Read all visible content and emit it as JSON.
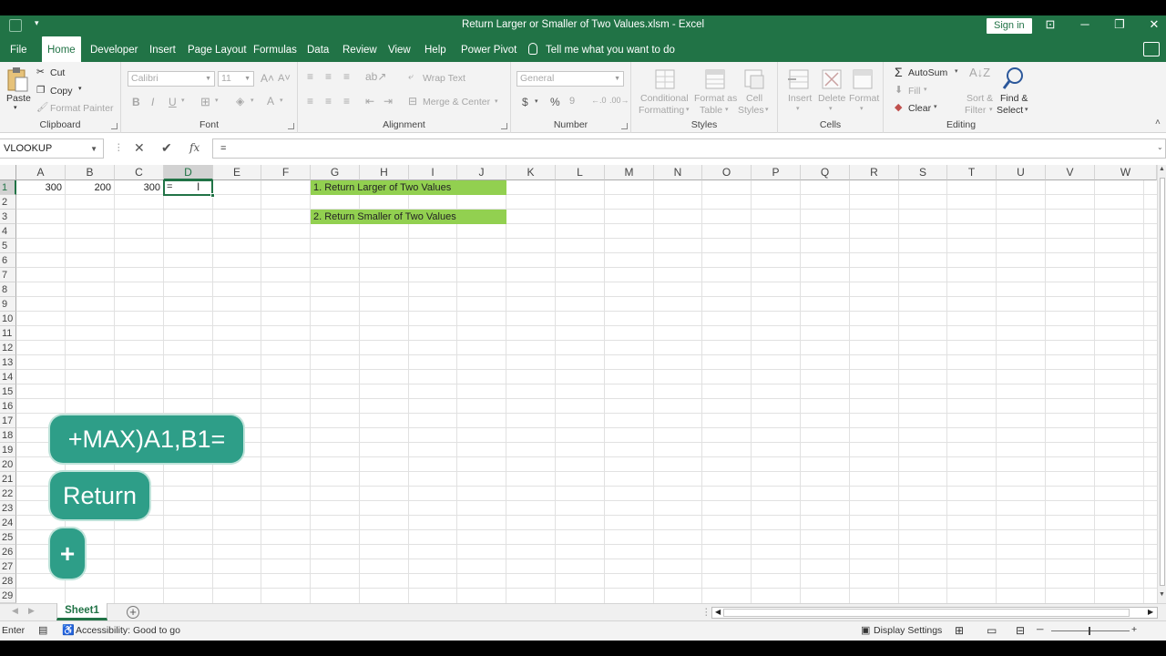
{
  "window": {
    "title": "Return Larger or Smaller of Two Values.xlsm  -  Excel",
    "sign_in": "Sign in"
  },
  "ribbon_tabs": [
    "File",
    "Home",
    "Developer",
    "Insert",
    "Page Layout",
    "Formulas",
    "Data",
    "Review",
    "View",
    "Help",
    "Power Pivot"
  ],
  "tell_me": "Tell me what you want to do",
  "clipboard": {
    "paste": "Paste",
    "cut": "Cut",
    "copy": "Copy",
    "format_painter": "Format Painter",
    "label": "Clipboard"
  },
  "font": {
    "name": "Calibri",
    "size": "11",
    "bold": "B",
    "italic": "I",
    "underline": "U",
    "label": "Font"
  },
  "alignment": {
    "wrap_text": "Wrap Text",
    "merge_center": "Merge & Center",
    "label": "Alignment"
  },
  "number": {
    "format": "General",
    "currency": "$",
    "percent": "%",
    "label": "Number"
  },
  "styles": {
    "conditional_1": "Conditional",
    "conditional_2": "Formatting",
    "format_as_1": "Format as",
    "format_as_2": "Table",
    "cell_styles_1": "Cell",
    "cell_styles_2": "Styles",
    "label": "Styles"
  },
  "cells": {
    "insert": "Insert",
    "delete": "Delete",
    "format": "Format",
    "label": "Cells"
  },
  "editing": {
    "autosum": "AutoSum",
    "fill": "Fill",
    "clear": "Clear",
    "sort_1": "Sort &",
    "sort_2": "Filter",
    "find_1": "Find &",
    "find_2": "Select",
    "label": "Editing"
  },
  "formula_bar": {
    "name_box": "VLOOKUP",
    "cancel": "✕",
    "enter": "✔",
    "fx": "fx",
    "content": "="
  },
  "columns": [
    "A",
    "B",
    "C",
    "D",
    "E",
    "F",
    "G",
    "H",
    "I",
    "J",
    "K",
    "L",
    "M",
    "N",
    "O",
    "P",
    "Q",
    "R",
    "S",
    "T",
    "U",
    "V",
    "W"
  ],
  "rows": [
    "1",
    "2",
    "3",
    "4",
    "5",
    "6",
    "7",
    "8",
    "9",
    "10",
    "11",
    "12",
    "13",
    "14",
    "15",
    "16",
    "17",
    "18",
    "19",
    "20",
    "21",
    "22",
    "23",
    "24",
    "25",
    "26",
    "27",
    "28",
    "29"
  ],
  "sheet_cells": {
    "A1": "300",
    "B1": "200",
    "C1": "300",
    "D1": "=",
    "G1": "1. Return Larger of Two Values",
    "G3": "2. Return Smaller of Two Values"
  },
  "overlay": {
    "formula": "+MAX)A1,B1=",
    "return": "Return",
    "plus": "+"
  },
  "sheet_tabs": [
    "Sheet1"
  ],
  "status_bar": {
    "mode": "Enter",
    "accessibility": "Accessibility: Good to go",
    "display_settings": "Display Settings"
  },
  "colors": {
    "excel_green": "#217346",
    "highlight_green": "#92d050",
    "overlay_teal": "#2e9e88"
  }
}
